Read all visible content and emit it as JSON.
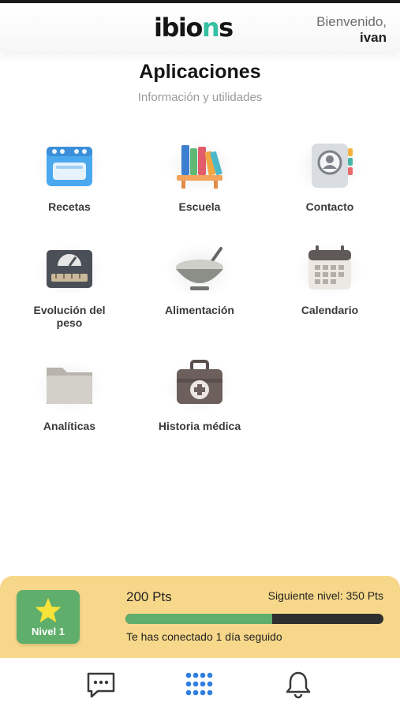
{
  "header": {
    "logo": {
      "part1": "ibio",
      "part2": "n",
      "part3": "s"
    },
    "welcome_line": "Bienvenido,",
    "user_name": "ivan"
  },
  "page": {
    "title": "Aplicaciones",
    "subtitle": "Información y utilidades"
  },
  "apps": [
    {
      "label": "Recetas",
      "icon": "oven-icon"
    },
    {
      "label": "Escuela",
      "icon": "books-icon"
    },
    {
      "label": "Contacto",
      "icon": "contact-book-icon"
    },
    {
      "label": "Evolución del peso",
      "icon": "scale-icon"
    },
    {
      "label": "Alimentación",
      "icon": "bowl-icon"
    },
    {
      "label": "Calendario",
      "icon": "calendar-icon"
    },
    {
      "label": "Analíticas",
      "icon": "folder-icon"
    },
    {
      "label": "Historia médica",
      "icon": "medical-kit-icon"
    }
  ],
  "level": {
    "badge_label": "Nivel 1",
    "points": "200 Pts",
    "next_level": "Siguiente nivel: 350 Pts",
    "progress_fraction": 0.57,
    "streak": "Te has conectado 1 día seguido"
  },
  "nav": {
    "items": [
      {
        "icon": "chat-icon",
        "active": false
      },
      {
        "icon": "apps-grid-icon",
        "active": true
      },
      {
        "icon": "bell-icon",
        "active": false
      }
    ]
  },
  "colors": {
    "accent_green": "#5fae6b",
    "panel_yellow": "#f7d88a",
    "active_blue": "#2f7fe0",
    "logo_teal": "#35c0a3"
  }
}
